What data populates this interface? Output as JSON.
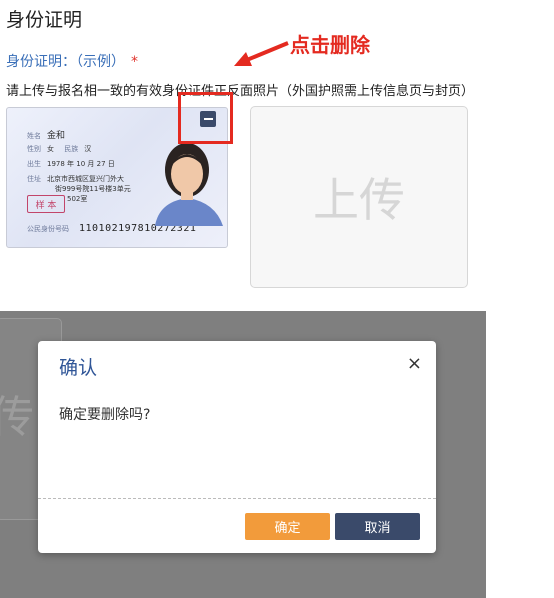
{
  "page": {
    "section_title": "身份证明",
    "id_label": "身份证明：（示例）",
    "required_mark": "*",
    "instruction": "请上传与报名相一致的有效身份证件正反面照片（外国护照需上传信息页与封页）",
    "annotation": "点击删除",
    "upload_placeholder": "上传"
  },
  "id_card": {
    "name_label": "姓名",
    "name": "金和",
    "sex_label": "性别",
    "sex": "女",
    "ethnic_label": "民族",
    "ethnic": "汉",
    "birth_label": "出生",
    "birth": "1978 年 10 月 27 日",
    "addr_label": "住址",
    "addr_1": "北京市西城区复兴门外大",
    "addr_2": "街999号院11号楼3单元",
    "addr_3": "502室",
    "seal": "样 本",
    "id_number_label": "公民身份号码",
    "id_number": "110102197810272321"
  },
  "background_shot": {
    "ghost_text": "传"
  },
  "dialog": {
    "title": "确认",
    "close": "×",
    "message": "确定要删除吗?",
    "ok_label": "确定",
    "cancel_label": "取消"
  },
  "colors": {
    "accent_red": "#e42a20",
    "ok_orange": "#f29b3b",
    "cancel_navy": "#3a4a6a",
    "title_blue": "#2f5597"
  }
}
